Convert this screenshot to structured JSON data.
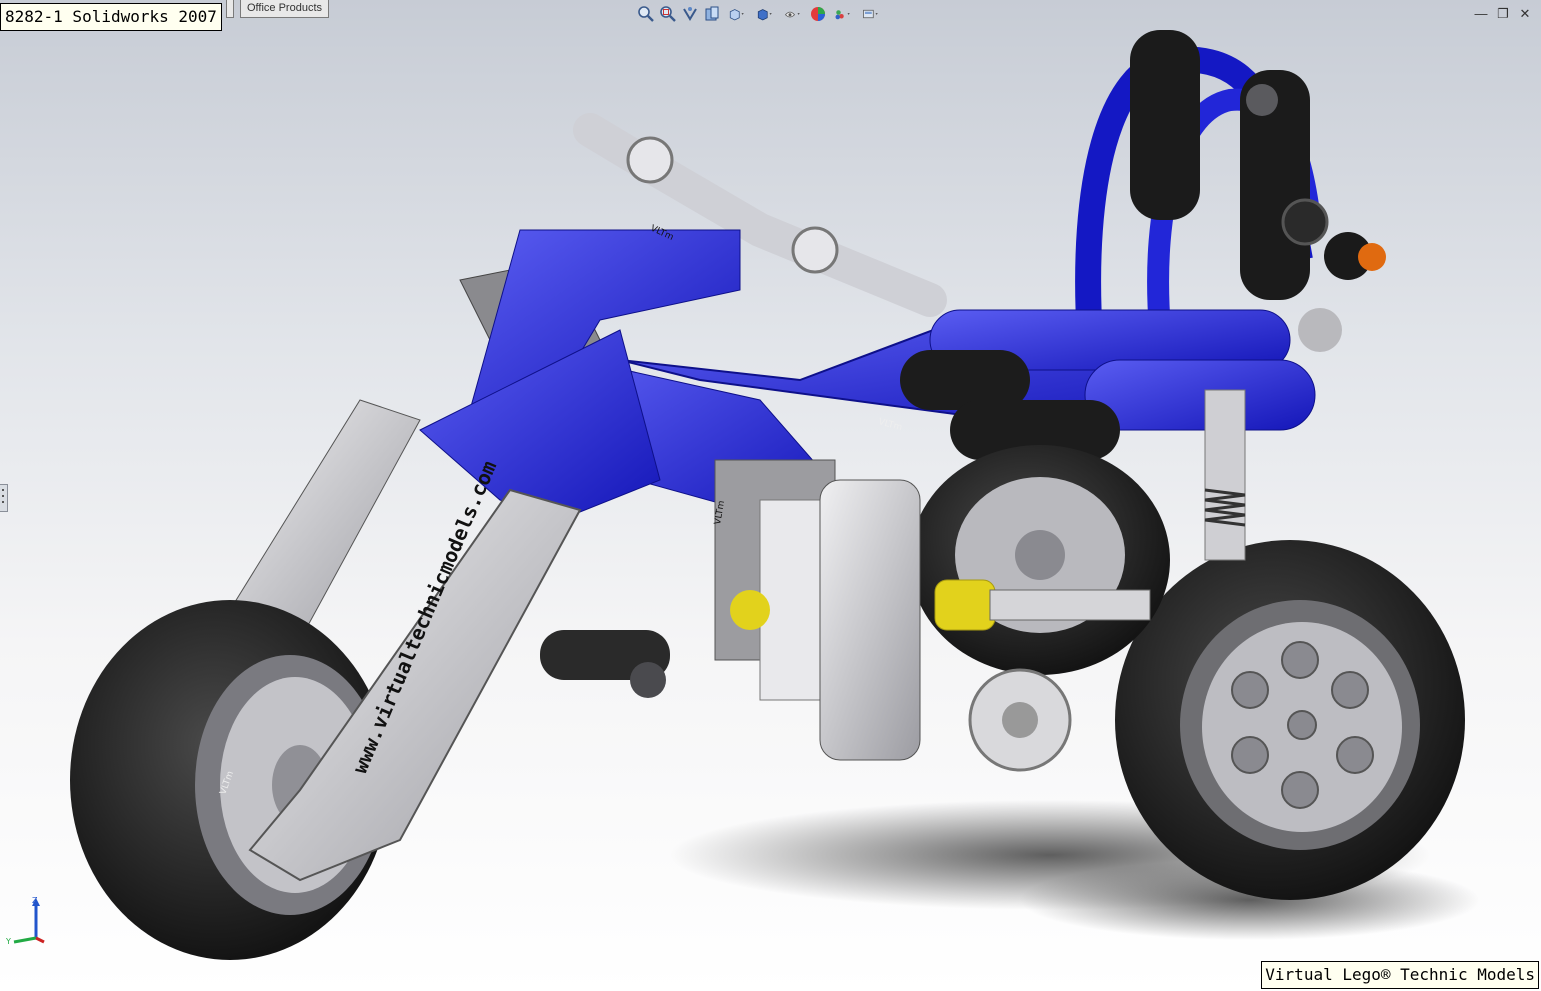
{
  "window": {
    "title": "8282-1 Solidworks 2007"
  },
  "tabs": [
    {
      "label": ""
    },
    {
      "label": "Office Products"
    }
  ],
  "heads_up_toolbar": [
    {
      "icon": "zoom-to-fit-icon"
    },
    {
      "icon": "zoom-to-area-icon"
    },
    {
      "icon": "previous-view-icon"
    },
    {
      "icon": "section-view-icon"
    },
    {
      "icon": "view-orientation-icon"
    },
    {
      "icon": "display-style-icon"
    },
    {
      "icon": "hide-show-items-icon"
    },
    {
      "icon": "edit-appearance-icon"
    },
    {
      "icon": "apply-scene-icon"
    },
    {
      "icon": "view-settings-icon"
    }
  ],
  "window_controls": {
    "minimize": "—",
    "restore": "❐",
    "close": "✕"
  },
  "model": {
    "watermark": "www.virtualtechnicmodels.com",
    "stamps": [
      "VLTm",
      "VLTm",
      "VLTm",
      "VLTm"
    ]
  },
  "triad": {
    "z": "Z",
    "y": "Y"
  },
  "footer": {
    "label": "Virtual Lego® Technic Models"
  },
  "colors": {
    "viewport_top": "#c7ccd5",
    "viewport_bottom": "#ffffff",
    "frame_blue": "#1c1fd6",
    "tire_black": "#1e1e1e",
    "light_gray": "#c9c9cc",
    "yellow": "#e2d21c",
    "orange": "#e06a10"
  }
}
